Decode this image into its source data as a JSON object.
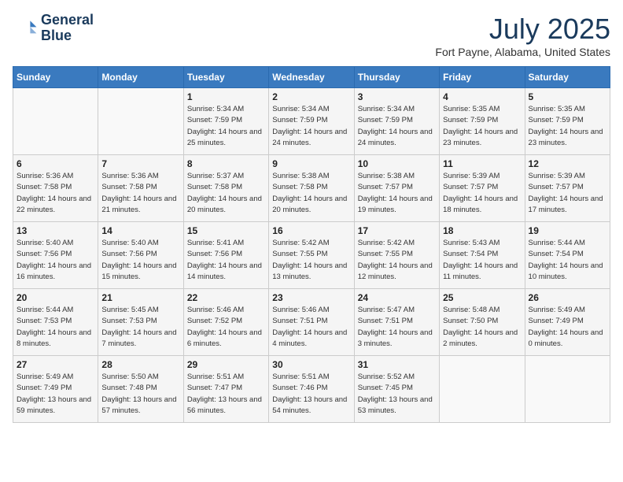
{
  "header": {
    "logo_line1": "General",
    "logo_line2": "Blue",
    "month_title": "July 2025",
    "location": "Fort Payne, Alabama, United States"
  },
  "days_of_week": [
    "Sunday",
    "Monday",
    "Tuesday",
    "Wednesday",
    "Thursday",
    "Friday",
    "Saturday"
  ],
  "weeks": [
    [
      {
        "day": "",
        "empty": true
      },
      {
        "day": "",
        "empty": true
      },
      {
        "day": "1",
        "sunrise": "Sunrise: 5:34 AM",
        "sunset": "Sunset: 7:59 PM",
        "daylight": "Daylight: 14 hours and 25 minutes."
      },
      {
        "day": "2",
        "sunrise": "Sunrise: 5:34 AM",
        "sunset": "Sunset: 7:59 PM",
        "daylight": "Daylight: 14 hours and 24 minutes."
      },
      {
        "day": "3",
        "sunrise": "Sunrise: 5:34 AM",
        "sunset": "Sunset: 7:59 PM",
        "daylight": "Daylight: 14 hours and 24 minutes."
      },
      {
        "day": "4",
        "sunrise": "Sunrise: 5:35 AM",
        "sunset": "Sunset: 7:59 PM",
        "daylight": "Daylight: 14 hours and 23 minutes."
      },
      {
        "day": "5",
        "sunrise": "Sunrise: 5:35 AM",
        "sunset": "Sunset: 7:59 PM",
        "daylight": "Daylight: 14 hours and 23 minutes."
      }
    ],
    [
      {
        "day": "6",
        "sunrise": "Sunrise: 5:36 AM",
        "sunset": "Sunset: 7:58 PM",
        "daylight": "Daylight: 14 hours and 22 minutes."
      },
      {
        "day": "7",
        "sunrise": "Sunrise: 5:36 AM",
        "sunset": "Sunset: 7:58 PM",
        "daylight": "Daylight: 14 hours and 21 minutes."
      },
      {
        "day": "8",
        "sunrise": "Sunrise: 5:37 AM",
        "sunset": "Sunset: 7:58 PM",
        "daylight": "Daylight: 14 hours and 20 minutes."
      },
      {
        "day": "9",
        "sunrise": "Sunrise: 5:38 AM",
        "sunset": "Sunset: 7:58 PM",
        "daylight": "Daylight: 14 hours and 20 minutes."
      },
      {
        "day": "10",
        "sunrise": "Sunrise: 5:38 AM",
        "sunset": "Sunset: 7:57 PM",
        "daylight": "Daylight: 14 hours and 19 minutes."
      },
      {
        "day": "11",
        "sunrise": "Sunrise: 5:39 AM",
        "sunset": "Sunset: 7:57 PM",
        "daylight": "Daylight: 14 hours and 18 minutes."
      },
      {
        "day": "12",
        "sunrise": "Sunrise: 5:39 AM",
        "sunset": "Sunset: 7:57 PM",
        "daylight": "Daylight: 14 hours and 17 minutes."
      }
    ],
    [
      {
        "day": "13",
        "sunrise": "Sunrise: 5:40 AM",
        "sunset": "Sunset: 7:56 PM",
        "daylight": "Daylight: 14 hours and 16 minutes."
      },
      {
        "day": "14",
        "sunrise": "Sunrise: 5:40 AM",
        "sunset": "Sunset: 7:56 PM",
        "daylight": "Daylight: 14 hours and 15 minutes."
      },
      {
        "day": "15",
        "sunrise": "Sunrise: 5:41 AM",
        "sunset": "Sunset: 7:56 PM",
        "daylight": "Daylight: 14 hours and 14 minutes."
      },
      {
        "day": "16",
        "sunrise": "Sunrise: 5:42 AM",
        "sunset": "Sunset: 7:55 PM",
        "daylight": "Daylight: 14 hours and 13 minutes."
      },
      {
        "day": "17",
        "sunrise": "Sunrise: 5:42 AM",
        "sunset": "Sunset: 7:55 PM",
        "daylight": "Daylight: 14 hours and 12 minutes."
      },
      {
        "day": "18",
        "sunrise": "Sunrise: 5:43 AM",
        "sunset": "Sunset: 7:54 PM",
        "daylight": "Daylight: 14 hours and 11 minutes."
      },
      {
        "day": "19",
        "sunrise": "Sunrise: 5:44 AM",
        "sunset": "Sunset: 7:54 PM",
        "daylight": "Daylight: 14 hours and 10 minutes."
      }
    ],
    [
      {
        "day": "20",
        "sunrise": "Sunrise: 5:44 AM",
        "sunset": "Sunset: 7:53 PM",
        "daylight": "Daylight: 14 hours and 8 minutes."
      },
      {
        "day": "21",
        "sunrise": "Sunrise: 5:45 AM",
        "sunset": "Sunset: 7:53 PM",
        "daylight": "Daylight: 14 hours and 7 minutes."
      },
      {
        "day": "22",
        "sunrise": "Sunrise: 5:46 AM",
        "sunset": "Sunset: 7:52 PM",
        "daylight": "Daylight: 14 hours and 6 minutes."
      },
      {
        "day": "23",
        "sunrise": "Sunrise: 5:46 AM",
        "sunset": "Sunset: 7:51 PM",
        "daylight": "Daylight: 14 hours and 4 minutes."
      },
      {
        "day": "24",
        "sunrise": "Sunrise: 5:47 AM",
        "sunset": "Sunset: 7:51 PM",
        "daylight": "Daylight: 14 hours and 3 minutes."
      },
      {
        "day": "25",
        "sunrise": "Sunrise: 5:48 AM",
        "sunset": "Sunset: 7:50 PM",
        "daylight": "Daylight: 14 hours and 2 minutes."
      },
      {
        "day": "26",
        "sunrise": "Sunrise: 5:49 AM",
        "sunset": "Sunset: 7:49 PM",
        "daylight": "Daylight: 14 hours and 0 minutes."
      }
    ],
    [
      {
        "day": "27",
        "sunrise": "Sunrise: 5:49 AM",
        "sunset": "Sunset: 7:49 PM",
        "daylight": "Daylight: 13 hours and 59 minutes."
      },
      {
        "day": "28",
        "sunrise": "Sunrise: 5:50 AM",
        "sunset": "Sunset: 7:48 PM",
        "daylight": "Daylight: 13 hours and 57 minutes."
      },
      {
        "day": "29",
        "sunrise": "Sunrise: 5:51 AM",
        "sunset": "Sunset: 7:47 PM",
        "daylight": "Daylight: 13 hours and 56 minutes."
      },
      {
        "day": "30",
        "sunrise": "Sunrise: 5:51 AM",
        "sunset": "Sunset: 7:46 PM",
        "daylight": "Daylight: 13 hours and 54 minutes."
      },
      {
        "day": "31",
        "sunrise": "Sunrise: 5:52 AM",
        "sunset": "Sunset: 7:45 PM",
        "daylight": "Daylight: 13 hours and 53 minutes."
      },
      {
        "day": "",
        "empty": true
      },
      {
        "day": "",
        "empty": true
      }
    ]
  ]
}
